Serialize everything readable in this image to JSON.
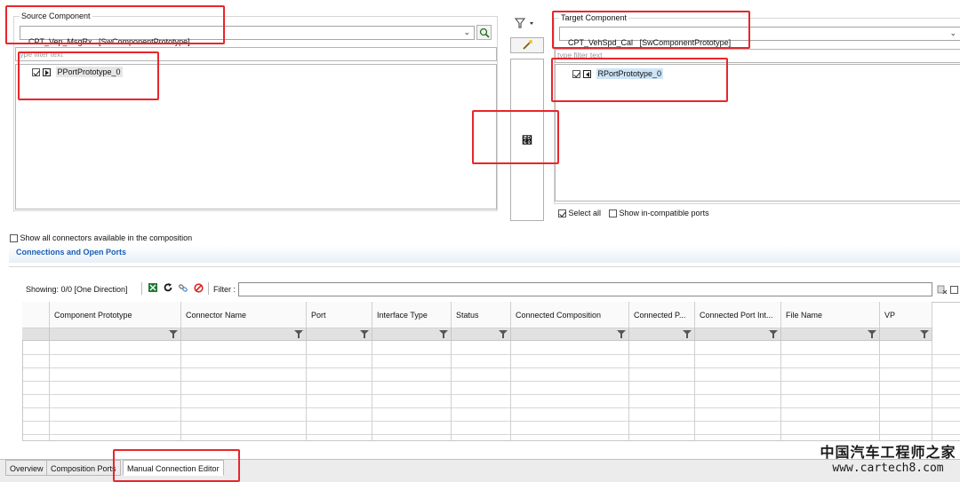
{
  "source": {
    "group_label": "Source Component",
    "combo_value": "CPT_Vep_MsgRx   [SwComponentPrototype]",
    "filter_placeholder": "type filter text",
    "port_label": "PPortPrototype_0"
  },
  "target": {
    "group_label": "Target Component",
    "combo_value": "CPT_VehSpd_Cal   [SwComponentPrototype]",
    "filter_placeholder": "type filter text",
    "port_label": "RPortPrototype_0",
    "select_all_label": "Select all",
    "show_incompatible_label": "Show in-compatible ports"
  },
  "connect_glyph": "⵨",
  "show_all_connectors_label": "Show all connectors available in the composition",
  "section_title": "Connections and Open Ports",
  "toolbar": {
    "showing_label": "Showing: 0/0 [One Direction]",
    "filter_label": "Filter :"
  },
  "table": {
    "columns": [
      "Component Prototype",
      "Connector Name",
      "Port",
      "Interface Type",
      "Status",
      "Connected Composition",
      "Connected P...",
      "Connected Port Int...",
      "File Name",
      "VP"
    ],
    "rows": []
  },
  "tabs": [
    "Overview",
    "Composition Ports",
    "Manual Connection Editor"
  ],
  "active_tab": "Manual Connection Editor",
  "watermark": {
    "line1": "中国汽车工程师之家",
    "line2": "www.cartech8.com"
  },
  "colors": {
    "highlight_red": "#e8262b",
    "section_title_blue": "#1a5fb4",
    "selection_blue": "#cde4f7"
  }
}
